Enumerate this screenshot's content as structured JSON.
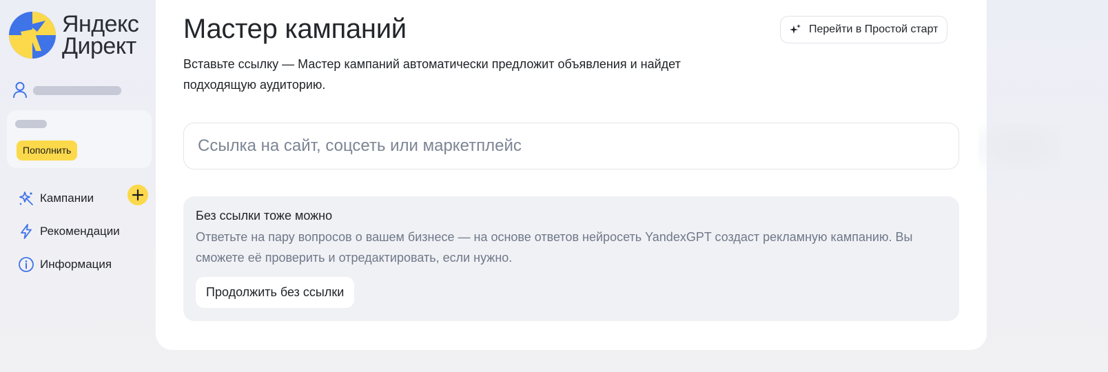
{
  "brand": {
    "line1": "Яндекс",
    "line2": "Директ",
    "yellow": "#fcd94a",
    "blue": "#3f73e8"
  },
  "account": {
    "icon": "user-icon"
  },
  "balance": {
    "topup_label": "Пополнить"
  },
  "nav": {
    "items": [
      {
        "label": "Кампании",
        "icon": "campaigns-sparkle-icon"
      },
      {
        "label": "Рекомендации",
        "icon": "lightning-icon"
      },
      {
        "label": "Информация",
        "icon": "info-icon"
      }
    ],
    "add_icon": "plus-icon"
  },
  "main": {
    "title": "Мастер кампаний",
    "simple_start_label": "Перейти в Простой старт",
    "subtitle": "Вставьте ссылку — Мастер кампаний автоматически предложит объявления и найдет подходящую аудиторию.",
    "url_input": {
      "placeholder": "Ссылка на сайт, соцсеть или маркетплейс",
      "value": ""
    },
    "no_link": {
      "title": "Без ссылки тоже можно",
      "text": "Ответьте на пару вопросов о вашем бизнесе — на основе ответов нейросеть YandexGPT создаст рекламную кампанию. Вы сможете её проверить и отредактировать, если нужно.",
      "button_label": "Продолжить без ссылки"
    }
  }
}
